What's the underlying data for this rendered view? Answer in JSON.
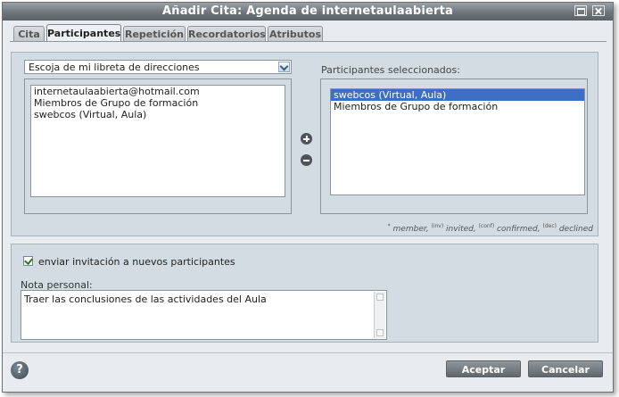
{
  "window": {
    "title": "Añadir Cita: Agenda de internetaulaabierta"
  },
  "tabs": [
    {
      "label": "Cita"
    },
    {
      "label": "Participantes"
    },
    {
      "label": "Repetición"
    },
    {
      "label": "Recordatorios"
    },
    {
      "label": "Atributos"
    }
  ],
  "active_tab": "Participantes",
  "source": {
    "selected_option": "Escoja de mi libreta de direcciones",
    "items": [
      "internetaulaabierta@hotmail.com",
      "Miembros de Grupo de formación",
      "swebcos (Virtual, Aula)"
    ]
  },
  "selected": {
    "label": "Participantes seleccionados:",
    "items": [
      {
        "text": "swebcos (Virtual, Aula)",
        "selected": true
      },
      {
        "text": "Miembros de Grupo de formación",
        "selected": false
      }
    ]
  },
  "legend": {
    "member_mark": "*",
    "member": "member,",
    "invited_mark": "(inv)",
    "invited": "invited,",
    "confirmed_mark": "(conf)",
    "confirmed": "confirmed,",
    "declined_mark": "(dec)",
    "declined": "declined"
  },
  "invite": {
    "checked": true,
    "label": "enviar invitación a nuevos participantes"
  },
  "note": {
    "label": "Nota personal:",
    "value": "Traer las conclusiones de las actividades del Aula"
  },
  "buttons": {
    "help": "?",
    "accept": "Aceptar",
    "cancel": "Cancelar"
  }
}
